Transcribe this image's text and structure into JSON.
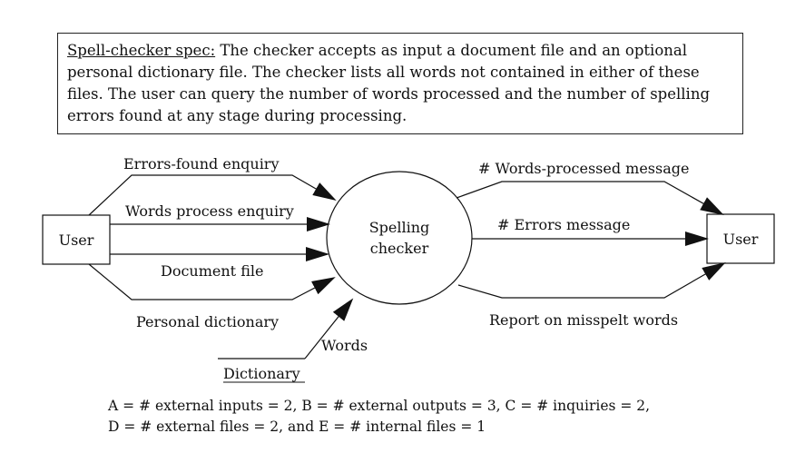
{
  "spec": {
    "lead": "Spell-checker spec:",
    "body": " The checker accepts as input a document file and an optional personal dictionary file. The checker lists all words not contained in either of these files. The user can query the number of words processed and the number of spelling errors found at any stage during processing."
  },
  "diagram": {
    "process": [
      "Spelling",
      "checker"
    ],
    "user_left": "User",
    "user_right": "User",
    "flows": {
      "errors_found_enquiry": "Errors-found enquiry",
      "words_process_enquiry": "Words process enquiry",
      "document_file": "Document file",
      "personal_dictionary": "Personal dictionary",
      "words": "Words",
      "dictionary": "Dictionary",
      "words_processed_message": "# Words-processed message",
      "errors_message": "# Errors message",
      "report_misspelt": "Report on misspelt words"
    }
  },
  "formula": {
    "line1": "A = # external inputs = 2,  B = # external outputs = 3,  C = # inquiries = 2,",
    "line2": "D = # external files = 2, and  E = # internal files = 1"
  }
}
